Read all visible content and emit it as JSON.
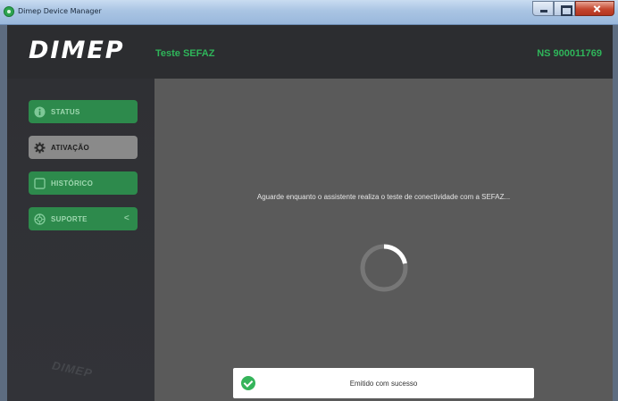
{
  "window": {
    "title": "Dimep Device Manager",
    "icon": "dimep-app-icon"
  },
  "header": {
    "logo_text": "DIMEP",
    "page_title": "Teste SEFAZ",
    "serial": "NS 900011769",
    "accent_color": "#2fb55a"
  },
  "sidebar": {
    "items": [
      {
        "label": "STATUS",
        "icon": "info-icon",
        "active": false
      },
      {
        "label": "ATIVAÇÃO",
        "icon": "gear-icon",
        "active": true
      },
      {
        "label": "HISTÓRICO",
        "icon": "document-icon",
        "active": false
      },
      {
        "label": "SUPORTE",
        "icon": "lifebuoy-icon",
        "active": false,
        "chevron": "<"
      }
    ],
    "watermark": "DIMEP"
  },
  "main": {
    "message": "Aguarde enquanto o assistente realiza o teste de conectividade com a SEFAZ...",
    "spinner": "loading-spinner"
  },
  "toast": {
    "text": "Emitido com sucesso",
    "icon": "check-circle-icon",
    "color": "#35b45a"
  }
}
